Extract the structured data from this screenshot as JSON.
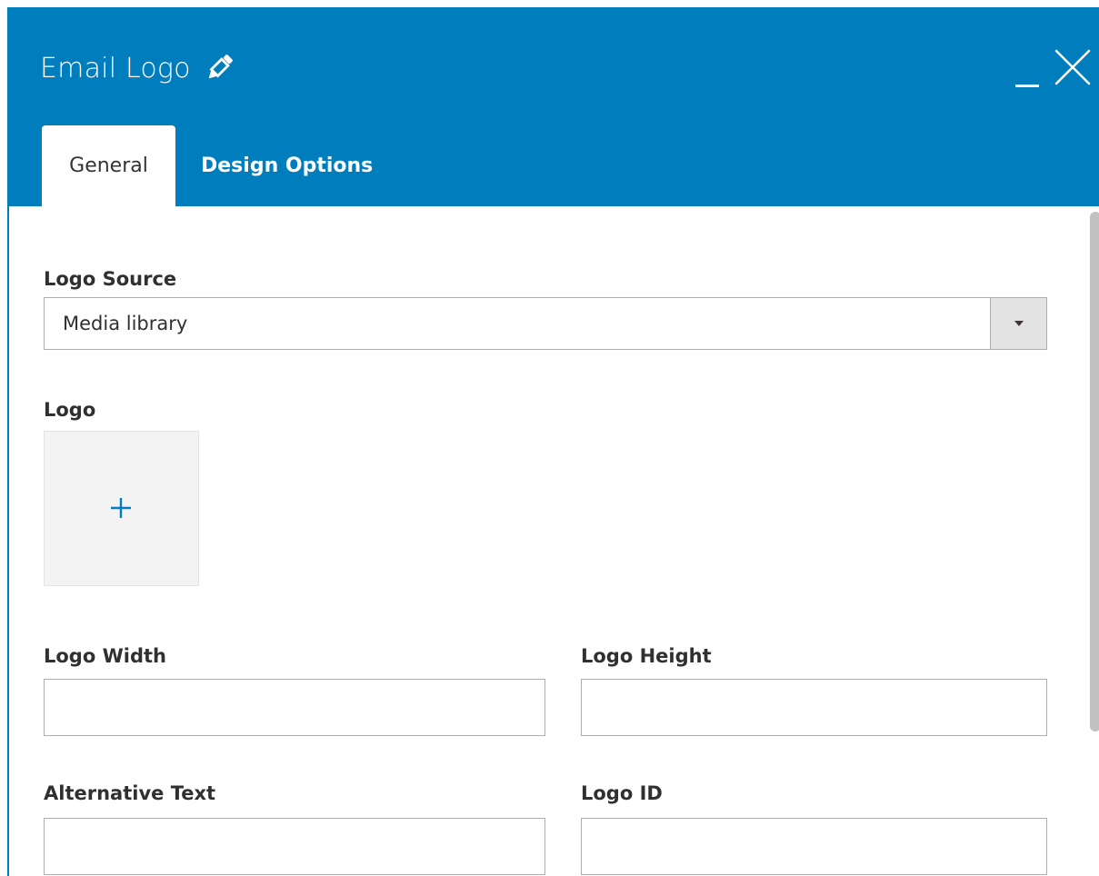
{
  "header": {
    "title": "Email Logo",
    "edit_icon": "pencil-icon",
    "minimize_icon": "minimize-icon",
    "close_icon": "close-icon",
    "background_color": "#007dbd"
  },
  "tabs": [
    {
      "label": "General",
      "active": true
    },
    {
      "label": "Design Options",
      "active": false
    }
  ],
  "form": {
    "logo_source": {
      "label": "Logo Source",
      "value": "Media library"
    },
    "logo": {
      "label": "Logo",
      "add_icon": "plus-icon"
    },
    "logo_width": {
      "label": "Logo Width",
      "value": ""
    },
    "logo_height": {
      "label": "Logo Height",
      "value": ""
    },
    "alternative_text": {
      "label": "Alternative Text",
      "value": ""
    },
    "logo_id": {
      "label": "Logo ID",
      "value": ""
    }
  },
  "colors": {
    "accent": "#007dbd",
    "label_text": "#303030",
    "border": "#adadad"
  }
}
